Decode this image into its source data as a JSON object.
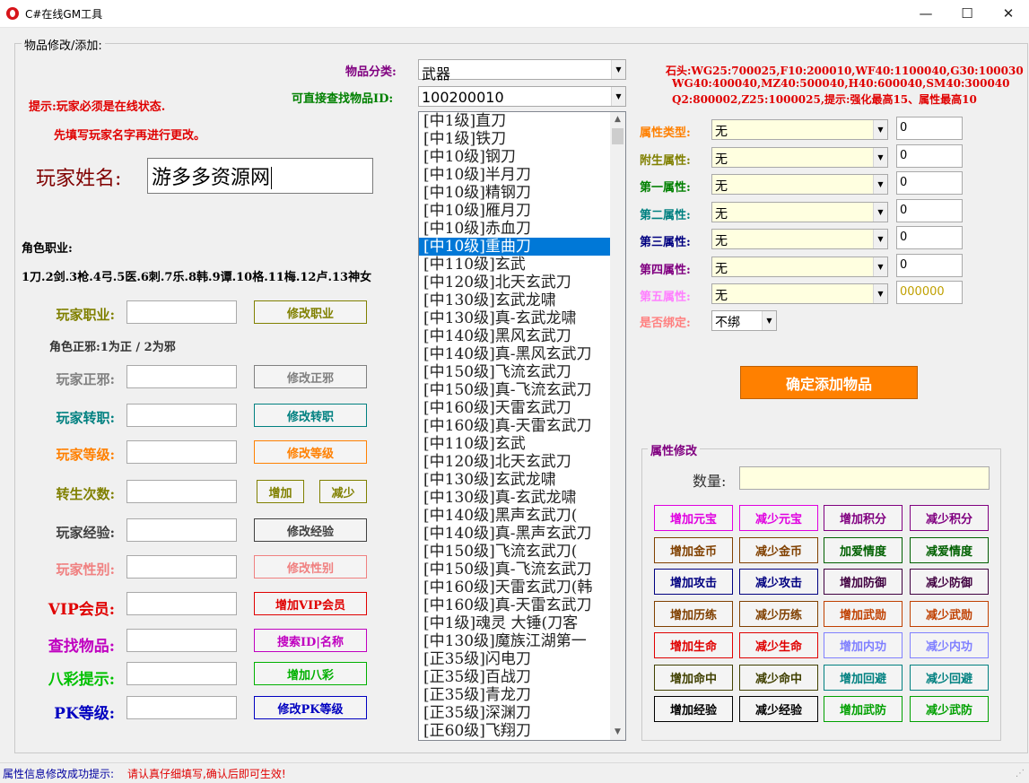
{
  "window": {
    "title": "C#在线GM工具",
    "minimize": "—",
    "maximize": "☐",
    "close": "✕"
  },
  "group_items": {
    "label": "物品修改/添加:"
  },
  "tips": {
    "line1": "提示:玩家必须是在线状态.",
    "line2": "先填写玩家名字再进行更改。"
  },
  "player": {
    "name_label": "玩家姓名:",
    "name_value": "游多多资源网",
    "job_header": "角色职业:",
    "job_list": "1刀.2剑.3枪.4弓.5医.6刺.7乐.8韩.9谭.10格.11梅.12卢.13神女",
    "alignment_note": "角色正邪:1为正 / 2为邪"
  },
  "rows": [
    {
      "label": "玩家职业:",
      "color": "#808000",
      "button": "修改职业",
      "btn_color": "#808000"
    },
    {
      "label": "玩家正邪:",
      "color": "#808080",
      "button": "修改正邪",
      "btn_color": "#808080"
    },
    {
      "label": "玩家转职:",
      "color": "#008080",
      "button": "修改转职",
      "btn_color": "#008080"
    },
    {
      "label": "玩家等级:",
      "color": "#ff8000",
      "button": "修改等级",
      "btn_color": "#ff8000"
    },
    {
      "label": "转生次数:",
      "color": "#808000",
      "button": "增加",
      "button2": "减少",
      "btn_color": "#808000"
    },
    {
      "label": "玩家经验:",
      "color": "#404040",
      "button": "修改经验",
      "btn_color": "#404040"
    },
    {
      "label": "玩家性别:",
      "color": "#f08080",
      "button": "修改性别",
      "btn_color": "#f08080"
    },
    {
      "label": "VIP会员:",
      "color": "#e00000",
      "button": "增加VIP会员",
      "btn_color": "#e00000"
    },
    {
      "label": "查找物品:",
      "color": "#c000c0",
      "button": "搜索ID|名称",
      "btn_color": "#c000c0"
    },
    {
      "label": "八彩提示:",
      "color": "#00c000",
      "button": "增加八彩",
      "btn_color": "#00b000"
    },
    {
      "label": "PK等级:",
      "color": "#0000c0",
      "button": "修改PK等级",
      "btn_color": "#0000c0"
    }
  ],
  "item_query": {
    "category_label": "物品分类:",
    "category_value": "武器",
    "direct_id_label": "可直接查找物品ID:",
    "direct_id_value": "100200010"
  },
  "item_list": [
    "[中1级]直刀",
    "[中1级]铁刀",
    "[中10级]钢刀",
    "[中10级]半月刀",
    "[中10级]精钢刀",
    "[中10级]雁月刀",
    "[中10级]赤血刀",
    "[中10级]重曲刀",
    "[中110级]玄武",
    "[中120级]北天玄武刀",
    "[中130级]玄武龙啸",
    "[中130级]真-玄武龙啸",
    "[中140级]黑风玄武刀",
    "[中140级]真-黑风玄武刀",
    "[中150级]飞流玄武刀",
    "[中150级]真-飞流玄武刀",
    "[中160级]天雷玄武刀",
    "[中160级]真-天雷玄武刀",
    "[中110级]玄武",
    "[中120级]北天玄武刀",
    "[中130级]玄武龙啸",
    "[中130级]真-玄武龙啸",
    "[中140级]黑声玄武刀(",
    "[中140级]真-黑声玄武刀",
    "[中150级]飞流玄武刀(",
    "[中150级]真-飞流玄武刀",
    "[中160级]天雷玄武刀(韩",
    "[中160级]真-天雷玄武刀",
    "[中1级]魂灵 大锤(刀客",
    "[中130级]魔族江湖第一",
    "[正35级]闪电刀",
    "[正35级]百战刀",
    "[正35级]青龙刀",
    "[正35级]深渊刀",
    "[正60级]飞翔刀"
  ],
  "selected_index": 7,
  "stone_info": {
    "line1": "石头:WG25:700025,F10:200010,WF40:1100040,G30:100030",
    "line2": "WG40:400040,MZ40:500040,H40:600040,SM40:300040",
    "line3": "Q2:800002,Z25:1000025,提示:强化最高15、属性最高10"
  },
  "attributes": [
    {
      "label": "属性类型:",
      "color": "#ff8000",
      "value": "无",
      "num": "0"
    },
    {
      "label": "附生属性:",
      "color": "#808000",
      "value": "无",
      "num": "0"
    },
    {
      "label": "第一属性:",
      "color": "#008000",
      "value": "无",
      "num": "0"
    },
    {
      "label": "第二属性:",
      "color": "#008080",
      "value": "无",
      "num": "0"
    },
    {
      "label": "第三属性:",
      "color": "#000080",
      "value": "无",
      "num": "0"
    },
    {
      "label": "第四属性:",
      "color": "#800080",
      "value": "无",
      "num": "0"
    },
    {
      "label": "第五属性:",
      "color": "#ff80ff",
      "value": "无",
      "num": "000000"
    }
  ],
  "bind": {
    "label": "是否绑定:",
    "value": "不绑"
  },
  "confirm_button": "确定添加物品",
  "attr_modify": {
    "label": "属性修改",
    "quantity_label": "数量:",
    "buttons": [
      {
        "text": "增加元宝",
        "color": "#e000e0"
      },
      {
        "text": "减少元宝",
        "color": "#e000e0"
      },
      {
        "text": "增加积分",
        "color": "#800080"
      },
      {
        "text": "减少积分",
        "color": "#800080"
      },
      {
        "text": "增加金币",
        "color": "#804000"
      },
      {
        "text": "减少金币",
        "color": "#804000"
      },
      {
        "text": "加爱情度",
        "color": "#006000"
      },
      {
        "text": "减爱情度",
        "color": "#006000"
      },
      {
        "text": "增加攻击",
        "color": "#000080"
      },
      {
        "text": "减少攻击",
        "color": "#000080"
      },
      {
        "text": "增加防御",
        "color": "#400040"
      },
      {
        "text": "减少防御",
        "color": "#400040"
      },
      {
        "text": "增加历练",
        "color": "#804000"
      },
      {
        "text": "减少历练",
        "color": "#804000"
      },
      {
        "text": "增加武勋",
        "color": "#c04000"
      },
      {
        "text": "减少武勋",
        "color": "#c04000"
      },
      {
        "text": "增加生命",
        "color": "#e00000"
      },
      {
        "text": "减少生命",
        "color": "#e00000"
      },
      {
        "text": "增加内功",
        "color": "#8080ff"
      },
      {
        "text": "减少内功",
        "color": "#8080ff"
      },
      {
        "text": "增加命中",
        "color": "#404000"
      },
      {
        "text": "减少命中",
        "color": "#404000"
      },
      {
        "text": "增加回避",
        "color": "#008080"
      },
      {
        "text": "减少回避",
        "color": "#008080"
      },
      {
        "text": "增加经验",
        "color": "#000000"
      },
      {
        "text": "减少经验",
        "color": "#000000"
      },
      {
        "text": "增加武防",
        "color": "#00a000"
      },
      {
        "text": "减少武防",
        "color": "#00a000"
      }
    ]
  },
  "status": {
    "label": "属性信息修改成功提示:",
    "message": "请认真仔细填写,确认后即可生效!"
  },
  "colors": {
    "tip_red": "#e00000",
    "confirm_bg": "#ff8000",
    "stone_red": "#e00000",
    "label_purple": "#800080",
    "label_green": "#008000",
    "status_blue": "#0000a0"
  }
}
